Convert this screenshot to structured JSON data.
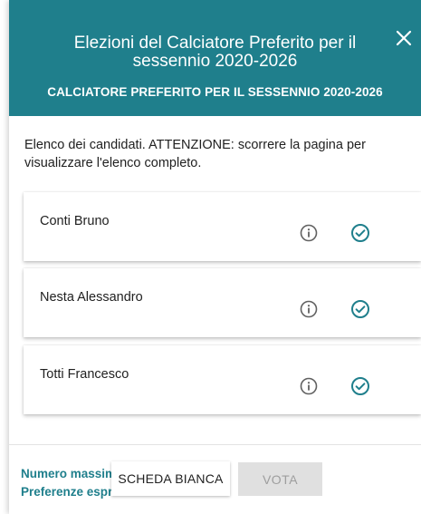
{
  "modal": {
    "title": "Elezioni del Calciatore Preferito per il sessennio 2020-2026",
    "subtitle": "CALCIATORE PREFERITO PER IL SESSENNIO 2020-2026",
    "close_icon": "close-icon"
  },
  "intro_text": "Elenco dei candidati. ATTENZIONE: scorrere la pagina per visualizzare l'elenco completo.",
  "candidates": [
    {
      "name": "Conti Bruno",
      "info_icon": "info-icon",
      "select_icon": "check-circle-icon"
    },
    {
      "name": "Nesta Alessandro",
      "info_icon": "info-icon",
      "select_icon": "check-circle-icon"
    },
    {
      "name": "Totti Francesco",
      "info_icon": "info-icon",
      "select_icon": "check-circle-icon"
    }
  ],
  "footer": {
    "max_prefs_line1": "Numero massimo",
    "max_prefs_line2": "Preferenze esprimibili",
    "blank_ballot_label": "SCHEDA BIANCA",
    "vote_label": "VOTA"
  },
  "colors": {
    "header_bg": "#1f7f8c",
    "accent": "#1f7f8c",
    "disabled_button_bg": "#e0e0e0"
  }
}
